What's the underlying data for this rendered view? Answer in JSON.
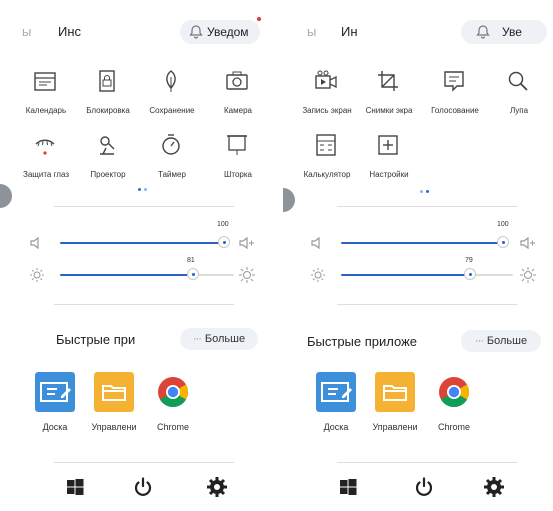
{
  "colors": {
    "accent": "#2a62c9",
    "board": "#3d8fdc",
    "folder": "#f5b132",
    "notif_dot": "#e53935"
  },
  "panels": [
    {
      "tabs": [
        "ы",
        "Инс"
      ],
      "notification": "Уведом",
      "tiles": [
        {
          "label": "Календарь",
          "icon": "calendar-icon"
        },
        {
          "label": "Блокировка",
          "icon": "lock-icon"
        },
        {
          "label": "Сохранение",
          "icon": "leaf-icon"
        },
        {
          "label": "Камера",
          "icon": "camera-icon"
        },
        {
          "label": "Защита глаз",
          "icon": "eye-protection-icon"
        },
        {
          "label": "Проектор",
          "icon": "projector-icon"
        },
        {
          "label": "Таймер",
          "icon": "timer-icon"
        },
        {
          "label": "Шторка",
          "icon": "curtain-icon"
        }
      ],
      "volume": "100",
      "brightness": "81",
      "quick_apps_title": "Быстрые при",
      "more": "Больше",
      "apps": [
        {
          "label": "Доска",
          "icon": "whiteboard-icon"
        },
        {
          "label": "Управлени",
          "icon": "folder-icon"
        },
        {
          "label": "Chrome",
          "icon": "chrome-icon"
        }
      ]
    },
    {
      "tabs": [
        "ы",
        "Ин"
      ],
      "notification": "Уве",
      "tiles": [
        {
          "label": "Запись экран",
          "icon": "screen-record-icon"
        },
        {
          "label": "Снимки экра",
          "icon": "screenshot-icon"
        },
        {
          "label": "Голосование",
          "icon": "vote-icon"
        },
        {
          "label": "Лупа",
          "icon": "magnifier-icon"
        },
        {
          "label": "Калькулятор",
          "icon": "calculator-icon"
        },
        {
          "label": "Настройки",
          "icon": "settings-plus-icon"
        }
      ],
      "volume": "100",
      "brightness": "79",
      "quick_apps_title": "Быстрые приложе",
      "more": "Больше",
      "apps": [
        {
          "label": "Доска",
          "icon": "whiteboard-icon"
        },
        {
          "label": "Управлени",
          "icon": "folder-icon"
        },
        {
          "label": "Chrome",
          "icon": "chrome-icon"
        }
      ]
    }
  ]
}
